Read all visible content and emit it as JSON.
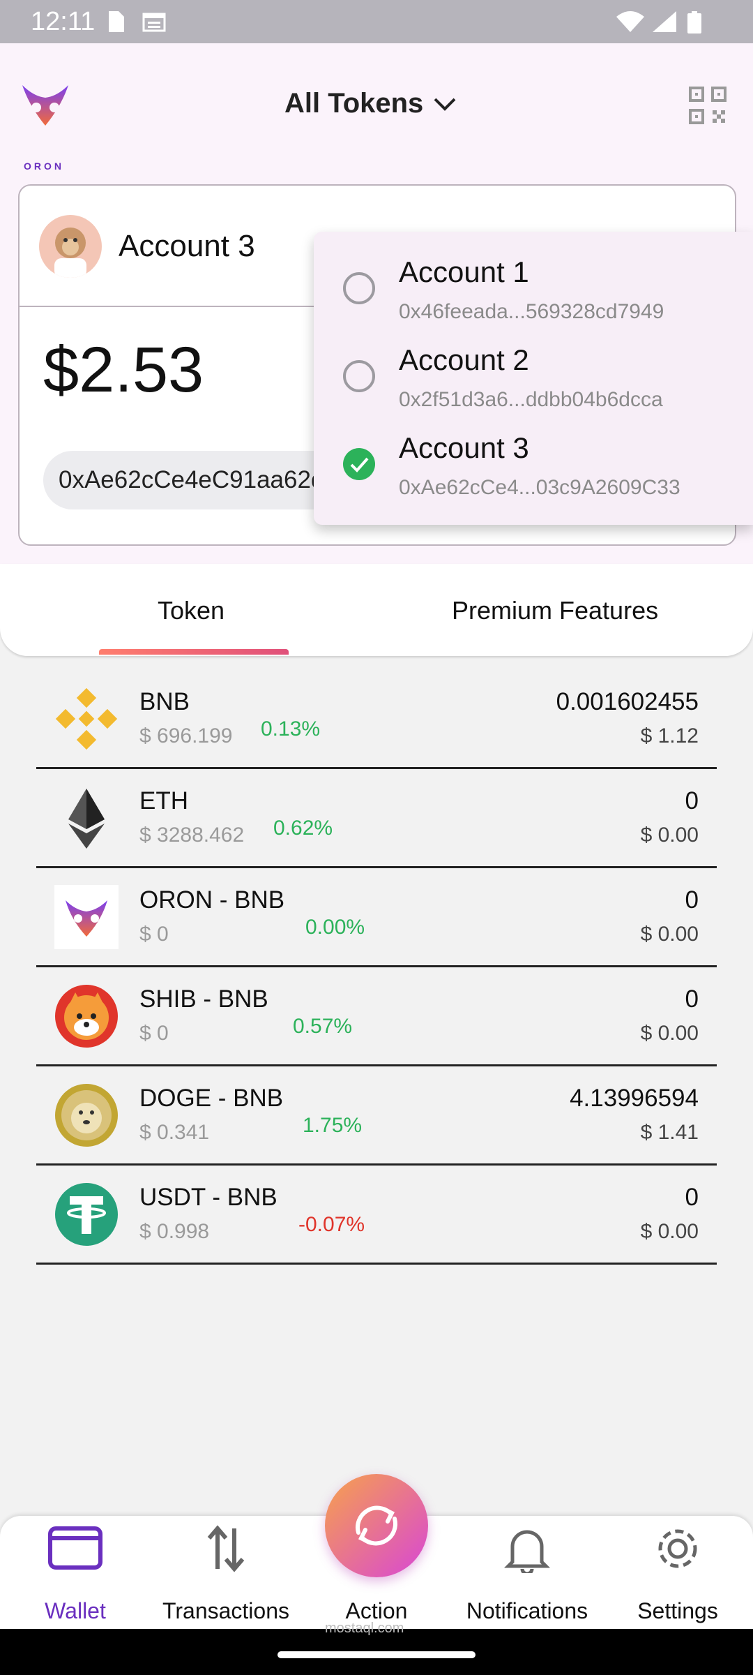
{
  "status_bar": {
    "time": "12:11"
  },
  "header": {
    "title": "All Tokens",
    "logo_text": "ORON"
  },
  "account_card": {
    "name": "Account 3",
    "balance": "$2.53",
    "address": "0xAe62cCe4eC91aa62d8244e..."
  },
  "account_dropdown": [
    {
      "name": "Account 1",
      "address": "0x46feeada...569328cd7949",
      "selected": false
    },
    {
      "name": "Account 2",
      "address": "0x2f51d3a6...ddbb04b6dcca",
      "selected": false
    },
    {
      "name": "Account 3",
      "address": "0xAe62cCe4...03c9A2609C33",
      "selected": true
    }
  ],
  "tabs": [
    {
      "label": "Token",
      "active": true
    },
    {
      "label": "Premium Features",
      "active": false
    }
  ],
  "tokens": [
    {
      "name": "BNB",
      "price": "$ 696.199",
      "change": "0.13%",
      "amount": "0.001602455",
      "value": "$ 1.12",
      "icon": "bnb-icon"
    },
    {
      "name": "ETH",
      "price": "$ 3288.462",
      "change": "0.62%",
      "amount": "0",
      "value": "$ 0.00",
      "icon": "eth-icon"
    },
    {
      "name": "ORON - BNB",
      "price": "$ 0",
      "change": "0.00%",
      "amount": "0",
      "value": "$ 0.00",
      "icon": "oron-icon"
    },
    {
      "name": "SHIB - BNB",
      "price": "$ 0",
      "change": "0.57%",
      "amount": "0",
      "value": "$ 0.00",
      "icon": "shib-icon"
    },
    {
      "name": "DOGE - BNB",
      "price": "$ 0.341",
      "change": "1.75%",
      "amount": "4.13996594",
      "value": "$ 1.41",
      "icon": "doge-icon"
    },
    {
      "name": "USDT - BNB",
      "price": "$ 0.998",
      "change": "-0.07%",
      "amount": "0",
      "value": "$ 0.00",
      "icon": "usdt-icon"
    }
  ],
  "bottom_nav": [
    {
      "label": "Wallet",
      "icon": "wallet-icon",
      "active": true
    },
    {
      "label": "Transactions",
      "icon": "arrows-updown-icon",
      "active": false
    },
    {
      "label": "Action",
      "icon": "swap-icon",
      "active": false
    },
    {
      "label": "Notifications",
      "icon": "bell-icon",
      "active": false
    },
    {
      "label": "Settings",
      "icon": "gear-icon",
      "active": false
    }
  ],
  "watermark": "mostaql.com",
  "colors": {
    "accent": "#6a2fbf",
    "positive": "#2cb25a",
    "negative": "#e0352b",
    "header_bg": "#fbf3fb"
  }
}
